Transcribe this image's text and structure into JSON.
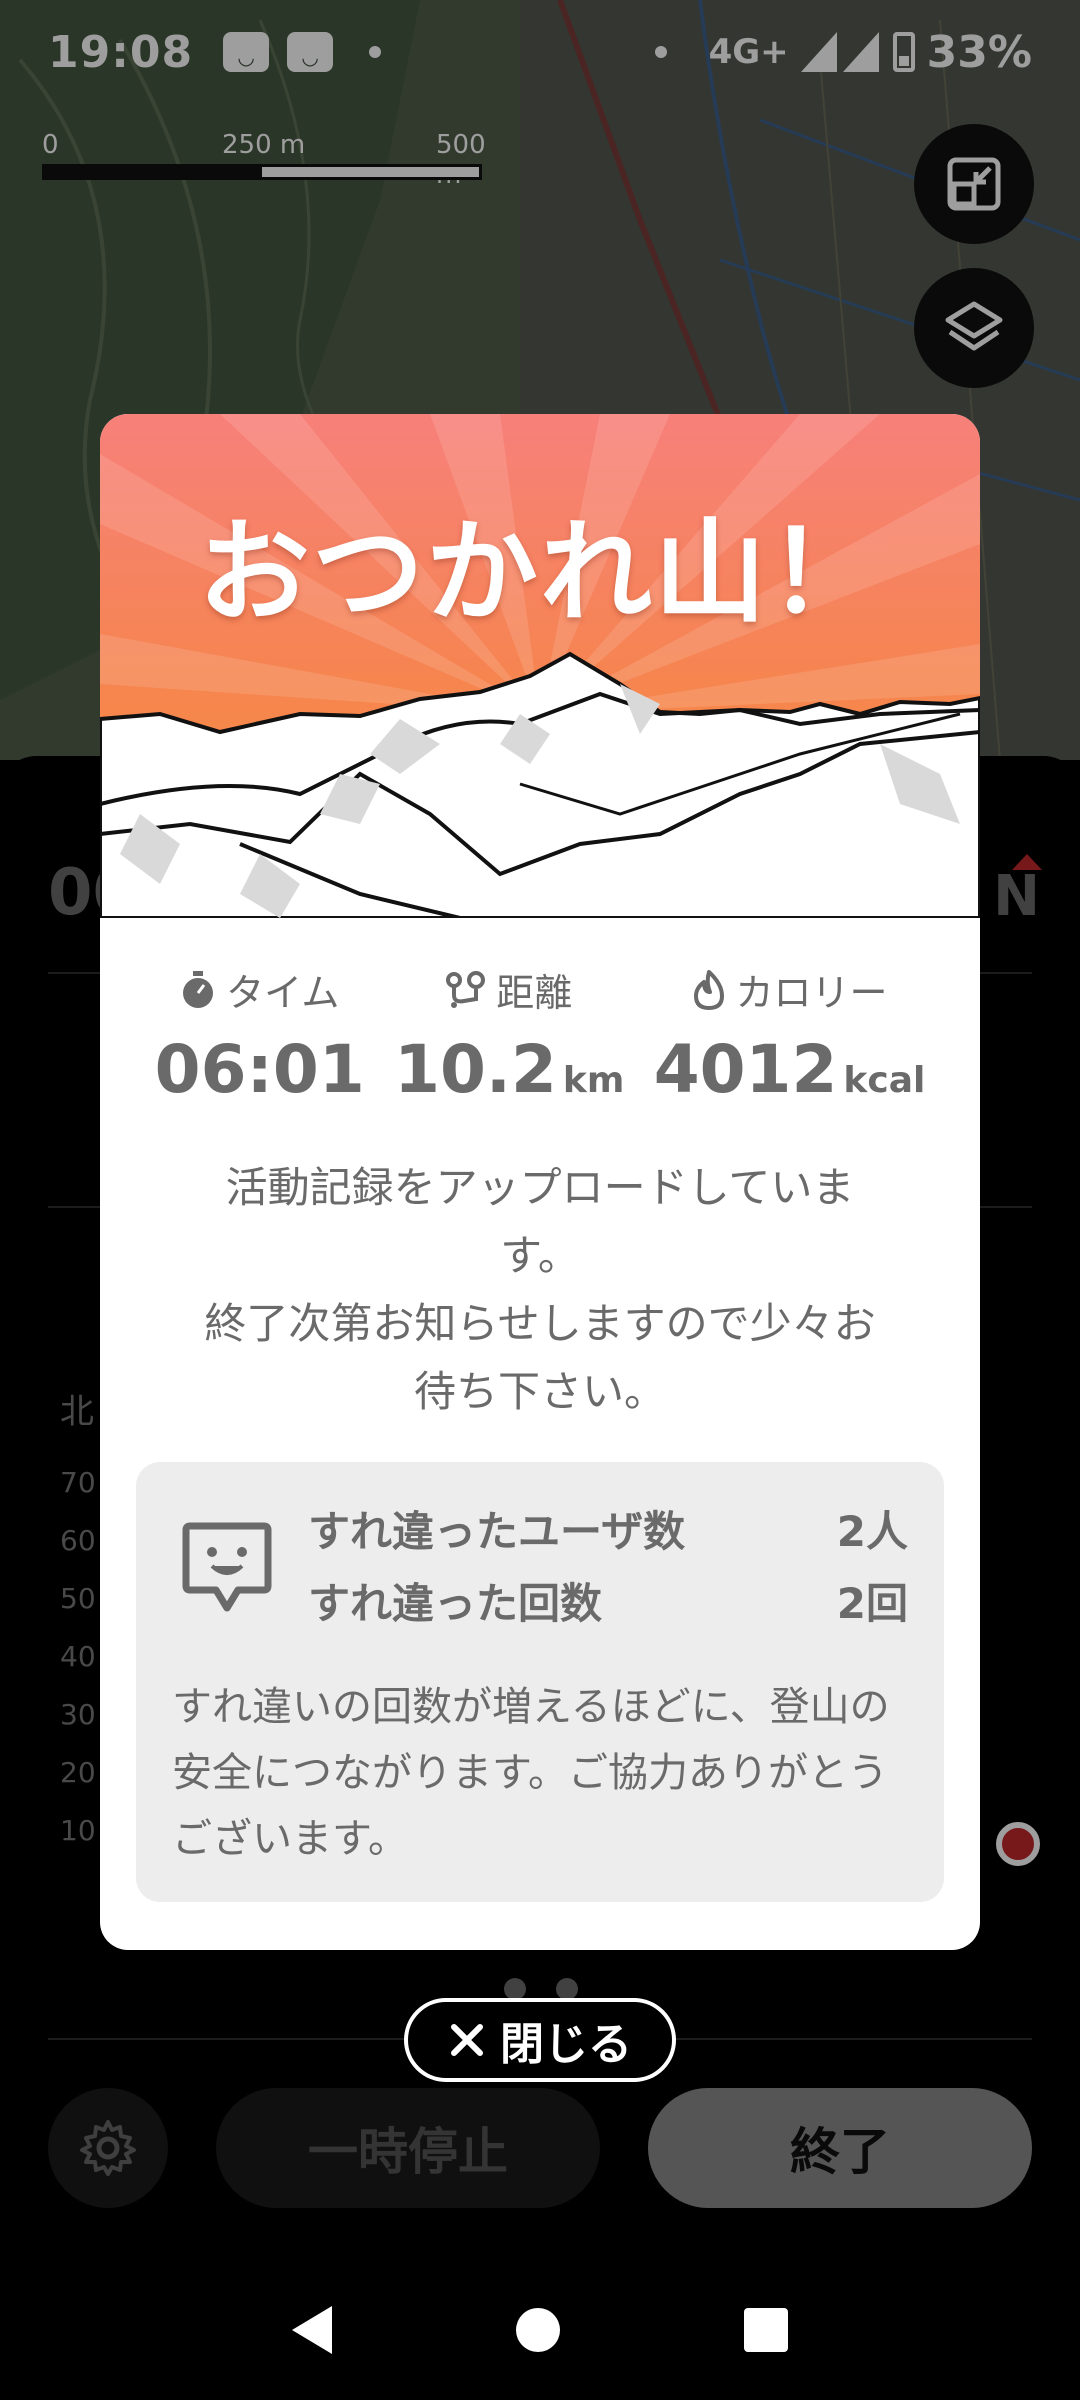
{
  "status_bar": {
    "time": "19:08",
    "network": "4G+",
    "battery": "33%"
  },
  "map": {
    "scale_labels": [
      "0",
      "250 m",
      "500 m"
    ],
    "expand_button_icon": "expand-icon",
    "layers_button_icon": "layers-icon"
  },
  "background_panel": {
    "peek_left": "00",
    "peek_right": "N",
    "side_label": "北",
    "elevation_ticks": [
      "70",
      "60",
      "50",
      "40",
      "30",
      "20",
      "10"
    ]
  },
  "modal": {
    "title": "おつかれ山！",
    "stats": {
      "time": {
        "label": "タイム",
        "value": "06:01",
        "unit": "",
        "icon": "stopwatch-icon"
      },
      "distance": {
        "label": "距離",
        "value": "10.2",
        "unit": "km",
        "icon": "route-icon"
      },
      "calories": {
        "label": "カロリー",
        "value": "4012",
        "unit": "kcal",
        "icon": "flame-icon"
      }
    },
    "upload_message_line1": "活動記録をアップロードしていま",
    "upload_message_line2": "す。",
    "upload_message_line3": "終了次第お知らせしますので少々お",
    "upload_message_line4": "待ち下さい。",
    "passing": {
      "users_label": "すれ違ったユーザ数",
      "users_value": "2人",
      "count_label": "すれ違った回数",
      "count_value": "2回",
      "note": "すれ違いの回数が増えるほどに、登山の安全につながります。ご協力ありがとうございます。"
    }
  },
  "close_button": "閉じる",
  "controls": {
    "pause": "一時停止",
    "end": "終了"
  }
}
